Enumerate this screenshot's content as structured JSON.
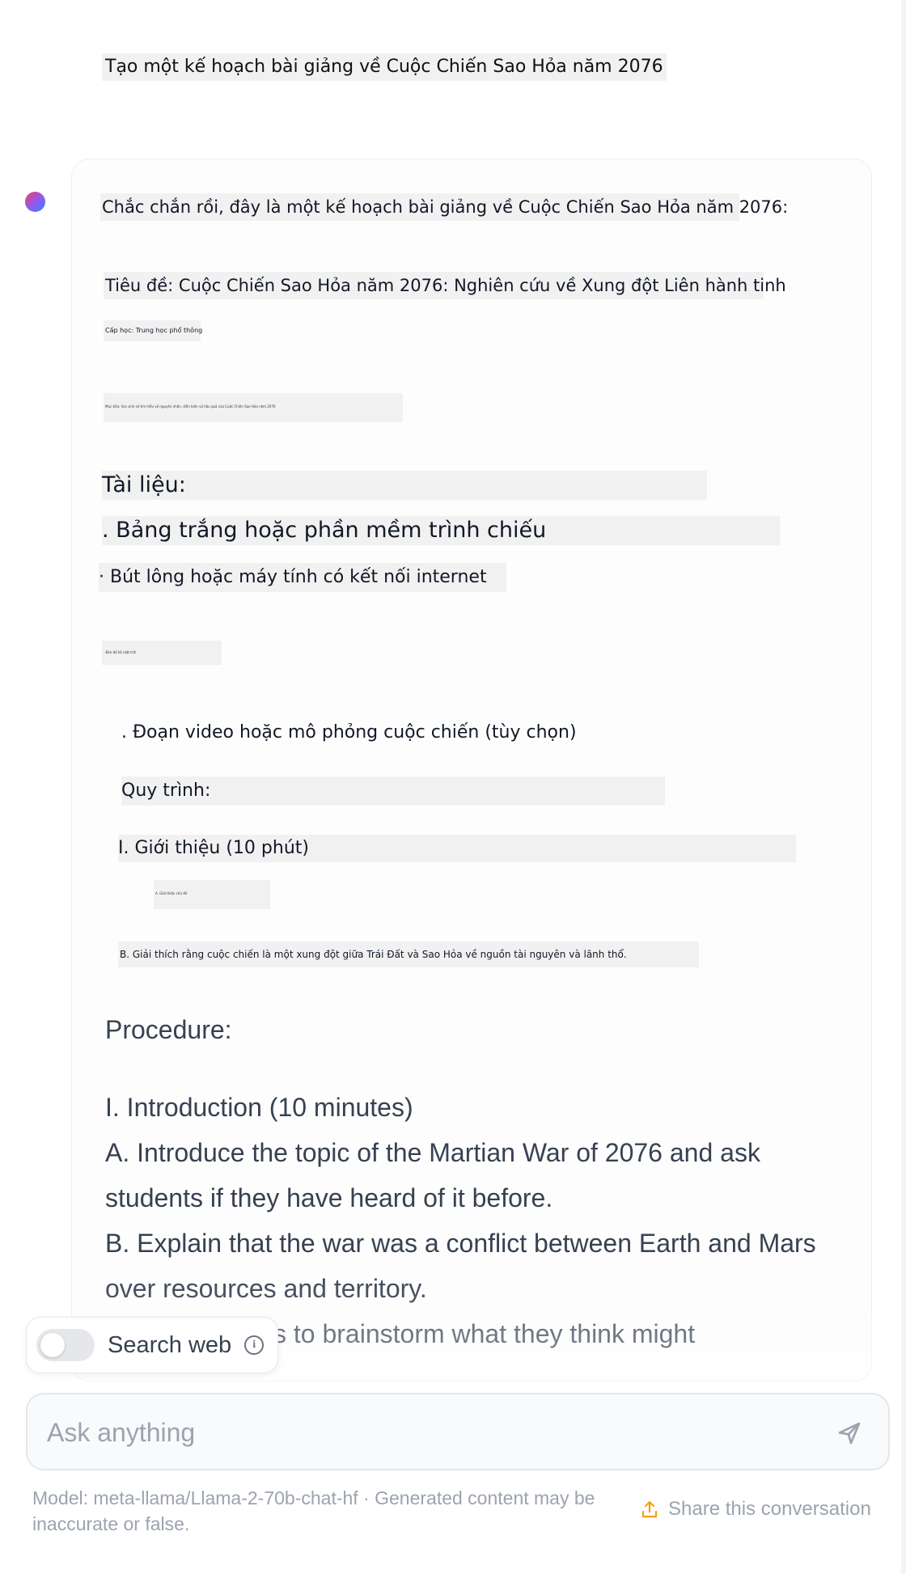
{
  "user_message": "Tạo một kế hoạch bài giảng về Cuộc Chiến Sao Hỏa năm 2076",
  "assistant": {
    "intro": "Chắc chắn rồi, đây là một kế hoạch bài giảng về Cuộc Chiến Sao Hỏa năm 2076:",
    "title_line": "Tiêu đề: Cuộc Chiến Sao Hỏa năm 2076: Nghiên cứu về Xung đột Liên hành tinh",
    "grade_line": "Cấp học: Trung học phổ thông",
    "objective_line": "Mục tiêu: học sinh sẽ tìm hiểu về nguyên nhân, diễn biến và hậu quả của Cuộc Chiến Sao Hỏa năm 2076",
    "materials_heading": "Tài liệu:",
    "material_1": ". Bảng trắng hoặc phần mềm trình chiếu",
    "material_2": "· Bút lông hoặc máy tính có kết nối internet",
    "material_3_tiny": "· Bản đồ hệ mặt trời",
    "material_4": ". Đoạn video hoặc mô phỏng cuộc chiến (tùy chọn)",
    "procedure_heading_vi": "Quy trình:",
    "intro_heading_vi": "I. Giới thiệu (10 phút)",
    "intro_a_tiny": "A. Giới thiệu chủ đề",
    "intro_b_vi": "B. Giải thích rằng cuộc chiến là một xung đột giữa Trái Đất và Sao Hỏa về nguồn tài nguyên và lãnh thổ.",
    "procedure_heading_en": "Procedure:",
    "intro_heading_en": "I. Introduction (10 minutes)",
    "intro_a_en_1": "A. Introduce the topic of the Martian War of 2076 and ask",
    "intro_a_en_2": "students if they have heard of it before.",
    "intro_b_en_1": "B. Explain that the war was a conflict between Earth and Mars",
    "intro_b_en_2": "over resources and territory.",
    "intro_c_en_partial": "s to brainstorm what they think might"
  },
  "search_web": {
    "label": "Search web",
    "enabled": false
  },
  "input": {
    "placeholder": "Ask anything"
  },
  "footer": {
    "note": "Model: meta-llama/Llama-2-70b-chat-hf · Generated content may be inaccurate or false.",
    "share_label": "Share this conversation"
  },
  "colors": {
    "accent_share": "#f59e0b",
    "text_muted": "#9ca3af"
  }
}
